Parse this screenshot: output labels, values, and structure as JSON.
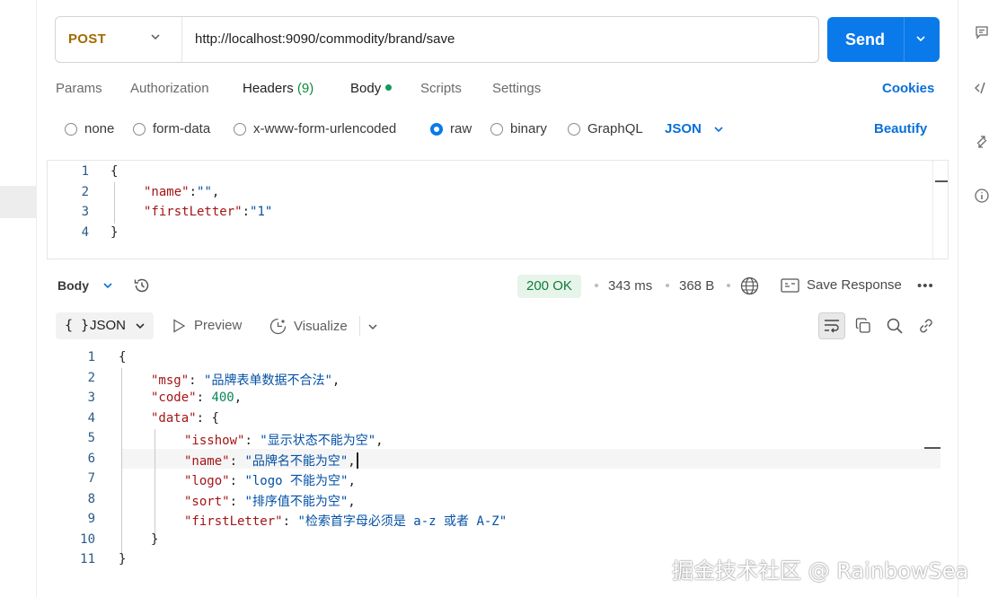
{
  "request": {
    "method": "POST",
    "url": "http://localhost:9090/commodity/brand/save",
    "send_label": "Send"
  },
  "tabs": {
    "params": "Params",
    "authorization": "Authorization",
    "headers": "Headers",
    "headers_count": "(9)",
    "body": "Body",
    "scripts": "Scripts",
    "settings": "Settings",
    "cookies": "Cookies"
  },
  "body_types": {
    "none": "none",
    "form_data": "form-data",
    "urlencoded": "x-www-form-urlencoded",
    "raw": "raw",
    "binary": "binary",
    "graphql": "GraphQL",
    "selected": "raw",
    "format": "JSON",
    "beautify": "Beautify"
  },
  "request_body": {
    "line_numbers": [
      "1",
      "2",
      "3",
      "4"
    ],
    "open": "{",
    "close": "}",
    "fields": [
      {
        "key": "\"name\"",
        "colon": ":",
        "value": "\"\"",
        "comma": ","
      },
      {
        "key": "\"firstLetter\"",
        "colon": ":",
        "value": "\"1\"",
        "comma": ""
      }
    ]
  },
  "response": {
    "section_label": "Body",
    "status": "200 OK",
    "time": "343 ms",
    "size": "368 B",
    "save_response": "Save Response",
    "more": "•••",
    "view_mode": "JSON",
    "view_mode_brace": "{ }",
    "preview": "Preview",
    "visualize": "Visualize"
  },
  "response_body": {
    "line_numbers": [
      "1",
      "2",
      "3",
      "4",
      "5",
      "6",
      "7",
      "8",
      "9",
      "10",
      "11"
    ],
    "open": "{",
    "close": "}",
    "msg_key": "\"msg\"",
    "msg_value": "\"品牌表单数据不合法\"",
    "code_key": "\"code\"",
    "code_value": "400",
    "data_key": "\"data\"",
    "data_open": "{",
    "data_close": "}",
    "data_fields": [
      {
        "key": "\"isshow\"",
        "value": "\"显示状态不能为空\"",
        "comma": ","
      },
      {
        "key": "\"name\"",
        "value": "\"品牌名不能为空\"",
        "comma": ","
      },
      {
        "key": "\"logo\"",
        "value": "\"logo 不能为空\"",
        "comma": ","
      },
      {
        "key": "\"sort\"",
        "value": "\"排序值不能为空\"",
        "comma": ","
      },
      {
        "key": "\"firstLetter\"",
        "value": "\"检索首字母必须是 a-z 或者 A-Z\"",
        "comma": ""
      }
    ]
  },
  "watermark": "掘金技术社区 @ RainbowSea",
  "colors": {
    "accent": "#0a7aea",
    "method": "#a36a00",
    "status_ok_bg": "#e6f4ea",
    "status_ok_text": "#0f7b3a",
    "json_key": "#a31515",
    "json_string": "#0451a5",
    "json_number": "#098658"
  },
  "icons": [
    "chevron-down-icon",
    "history-icon",
    "globe-icon",
    "save-response-icon",
    "preview-play-icon",
    "visualize-icon",
    "wrap-lines-icon",
    "copy-icon",
    "search-icon",
    "link-icon",
    "comment-icon",
    "code-icon",
    "arrows-icon",
    "info-icon"
  ]
}
